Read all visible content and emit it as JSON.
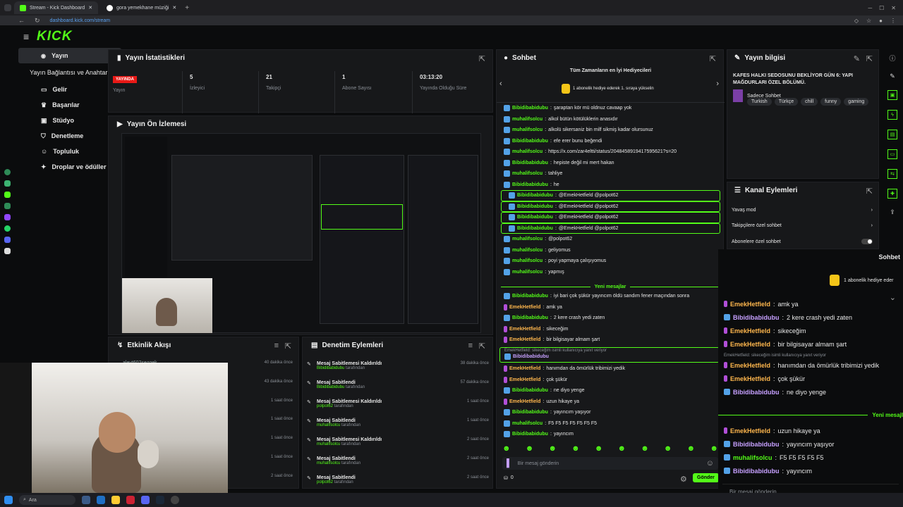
{
  "browser": {
    "tabs": [
      {
        "label": "Stream - Kick Dashboard",
        "active": true
      },
      {
        "label": "gora yemekhane müziği",
        "active": false
      }
    ],
    "new_tab": "+",
    "url": "dashboard.kick.com/stream"
  },
  "sidebar": {
    "logo": "KICK",
    "items": [
      {
        "label": "Yayın",
        "selected": true,
        "icon": "broadcast-icon"
      },
      {
        "label": "Yayın Bağlantısı ve Anahtarı",
        "selected": false,
        "icon": ""
      },
      {
        "label": "Gelir",
        "selected": false,
        "icon": "money-icon"
      },
      {
        "label": "Başarılar",
        "selected": false,
        "icon": "trophy-icon"
      },
      {
        "label": "Stüdyo",
        "selected": false,
        "icon": "studio-icon",
        "chevron": true
      },
      {
        "label": "Denetleme",
        "selected": false,
        "icon": "shield-icon"
      },
      {
        "label": "Topluluk",
        "selected": false,
        "icon": "community-icon",
        "chevron": true
      },
      {
        "label": "Droplar ve ödüller",
        "selected": false,
        "icon": "gift-icon"
      }
    ]
  },
  "stats": {
    "title": "Yayın İstatistikleri",
    "live_badge": "YAYINDA",
    "columns": [
      {
        "value": "",
        "label": "Yayın"
      },
      {
        "value": "5",
        "label": "İzleyici"
      },
      {
        "value": "21",
        "label": "Takipçi"
      },
      {
        "value": "1",
        "label": "Abone Sayısı"
      },
      {
        "value": "03:13:20",
        "label": "Yayında Olduğu Süre"
      }
    ]
  },
  "preview": {
    "title": "Yayın Ön İzlemesi"
  },
  "activity": {
    "title": "Etkinlik Akışı",
    "first_user": "aleyt602sezgek",
    "times": [
      "40 dakika önce",
      "43 dakika önce",
      "1 saat önce",
      "1 saat önce",
      "1 saat önce",
      "1 saat önce",
      "2 saat önce"
    ]
  },
  "moderation": {
    "title": "Denetim Eylemleri",
    "rows": [
      {
        "action": "Mesaj Sabitlemesi Kaldırıldı",
        "user": "Bibidibabidubu",
        "suffix": "tarafından",
        "time": "38 dakika önce"
      },
      {
        "action": "Mesaj Sabitlendi",
        "user": "Bibidibabidubu",
        "suffix": "tarafından",
        "time": "57 dakika önce"
      },
      {
        "action": "Mesaj Sabitlemesi Kaldırıldı",
        "user": "polpot62",
        "suffix": "tarafından",
        "time": "1 saat önce"
      },
      {
        "action": "Mesaj Sabitlendi",
        "user": "muhalifsolcu",
        "suffix": "tarafından",
        "time": "1 saat önce"
      },
      {
        "action": "Mesaj Sabitlemesi Kaldırıldı",
        "user": "muhalifsolcu",
        "suffix": "tarafından",
        "time": "2 saat önce"
      },
      {
        "action": "Mesaj Sabitlendi",
        "user": "muhalifsolcu",
        "suffix": "tarafından",
        "time": "2 saat önce"
      },
      {
        "action": "Mesaj Sabitlendi",
        "user": "polpot62",
        "suffix": "tarafından",
        "time": "2 saat önce"
      }
    ]
  },
  "chat": {
    "title": "Sohbet",
    "gifters_title": "Tüm Zamanların en İyi Hediyecileri",
    "gifters_sub": "1 abonelik hediye ederek 1. sıraya yükselin",
    "new_messages": "Yeni mesajlar",
    "reply_hint": "EmekHetfield: sikeceğim isimli kullanıcıya yanıt veriyor",
    "input_placeholder": "Bir mesaj gönderin",
    "send_label": "Gönder",
    "counter": "0",
    "messages": [
      {
        "user": "Bibidibabidubu",
        "color": "green",
        "text": "şaraptan kör mü oldnuz cavaap yok",
        "hl": false
      },
      {
        "user": "muhalifsolcu",
        "color": "green",
        "text": "alkol bütün kötülüklerin anasıdır",
        "hl": false
      },
      {
        "user": "muhalifsolcu",
        "color": "green",
        "text": "alkolü sikersaniz bin milf sikmiş kadar olursunuz",
        "hl": false
      },
      {
        "user": "Bibidibabidubu",
        "color": "green",
        "text": "efe erer bunu beğendi",
        "hl": false
      },
      {
        "user": "muhalifsolcu",
        "color": "green",
        "text": "https://x.com/zar4eltti/status/2048458919417595621?s=20",
        "hl": false
      },
      {
        "user": "Bibidibabidubu",
        "color": "green",
        "text": "hepiste değil mi mert hakan",
        "hl": false
      },
      {
        "user": "muhalifsolcu",
        "color": "green",
        "text": "tahliye",
        "hl": false
      },
      {
        "user": "Bibidibabidubu",
        "color": "green",
        "text": "he",
        "hl": false
      },
      {
        "user": "Bibidibabidubu",
        "color": "green",
        "text": "@EmekHetfield @polpot62",
        "hl": true
      },
      {
        "user": "Bibidibabidubu",
        "color": "green",
        "text": "@EmekHetfield @polpot62",
        "hl": true
      },
      {
        "user": "Bibidibabidubu",
        "color": "green",
        "text": "@EmekHetfield @polpot62",
        "hl": true
      },
      {
        "user": "Bibidibabidubu",
        "color": "green",
        "text": "@EmekHetfield @polpot62",
        "hl": true
      },
      {
        "user": "muhalifsolcu",
        "color": "green",
        "text": "@polpot62",
        "hl": false
      },
      {
        "user": "muhalifsolcu",
        "color": "green",
        "text": "geliyomus",
        "hl": false
      },
      {
        "user": "muhalifsolcu",
        "color": "green",
        "text": "poyi yapmaya çalışıyomus",
        "hl": false
      },
      {
        "user": "muhalifsolcu",
        "color": "green",
        "text": "yapmış",
        "hl": false
      }
    ],
    "messages_after": [
      {
        "user": "Bibidibabidubu",
        "color": "green",
        "text": "iyi bari çok şükür yayıncım öldü sandım fener maçından sonra"
      },
      {
        "user": "EmekHetfield",
        "color": "orange",
        "text": "amk ya"
      },
      {
        "user": "Bibidibabidubu",
        "color": "green",
        "text": "2 kere crash yedi zaten"
      },
      {
        "user": "EmekHetfield",
        "color": "orange",
        "text": "sikeceğim"
      },
      {
        "user": "EmekHetfield",
        "color": "orange",
        "text": "bir bilgisayar almam şart"
      }
    ],
    "messages_reply": [
      {
        "user": "EmekHetfield",
        "color": "orange",
        "text": "hanımdan da ömürlük tribimizi yedik"
      },
      {
        "user": "EmekHetfield",
        "color": "orange",
        "text": "çok şükür"
      },
      {
        "user": "Bibidibabidubu",
        "color": "green",
        "text": "ne diyo yenge"
      },
      {
        "user": "EmekHetfield",
        "color": "orange",
        "text": "uzun hikaye ya"
      },
      {
        "user": "Bibidibabidubu",
        "color": "green",
        "text": "yayıncım yaşıyor"
      },
      {
        "user": "muhalifsolcu",
        "color": "green",
        "text": "F5   F5   F5   F5   F5   F5   F5"
      },
      {
        "user": "Bibidibabidubu",
        "color": "green",
        "text": "yayıncım"
      }
    ]
  },
  "info": {
    "title": "Yayın bilgisi",
    "stream_title": "KAFES HALKI SEDOSUNU BEKLİYOR GÜN 6: YAPI MAĞDURLARI ÖZEL BÖLÜMÜ.",
    "category": "Sadece Sohbet",
    "tags": [
      "Turkish",
      "Türkçe",
      "chill",
      "funny",
      "gaming"
    ]
  },
  "channel": {
    "title": "Kanal Eylemleri",
    "items": [
      "Yavaş mod",
      "Takipçilere özel sohbet",
      "Abonelere özel sohbet"
    ]
  },
  "overlay": {
    "title": "Sohbet",
    "gift": "1 abonelik hediye eder",
    "new_messages": "Yeni mesajl",
    "reply_hint": "EmekHetfield: sikeceğim isimli kullanıcıya yanıt veriyor",
    "input_placeholder": "Bir mesaj gönderin",
    "lines": [
      {
        "user": "EmekHetfield",
        "color": "orange",
        "text": "amk ya"
      },
      {
        "user": "Bibidibabidubu",
        "color": "purple",
        "text": "2 kere crash yedi zaten"
      },
      {
        "user": "EmekHetfield",
        "color": "orange",
        "text": "sikeceğim"
      },
      {
        "user": "EmekHetfield",
        "color": "orange",
        "text": "bir bilgisayar almam şart"
      }
    ],
    "lines2": [
      {
        "user": "EmekHetfield",
        "color": "orange",
        "text": "hanımdan da ömürlük tribimizi yedik"
      },
      {
        "user": "EmekHetfield",
        "color": "orange",
        "text": "çok şükür"
      },
      {
        "user": "Bibidibabidubu",
        "color": "purple",
        "text": "ne diyo yenge"
      }
    ],
    "lines3": [
      {
        "user": "EmekHetfield",
        "color": "orange",
        "text": "uzun hikaye ya"
      },
      {
        "user": "Bibidibabidubu",
        "color": "purple",
        "text": "yayıncım yaşıyor"
      },
      {
        "user": "muhalifsolcu",
        "color": "green",
        "text": "F5   F5   F5   F5   F5"
      },
      {
        "user": "Bibidibabidubu",
        "color": "purple",
        "text": "yayıncım"
      }
    ]
  },
  "taskbar": {
    "search_placeholder": "Ara"
  }
}
